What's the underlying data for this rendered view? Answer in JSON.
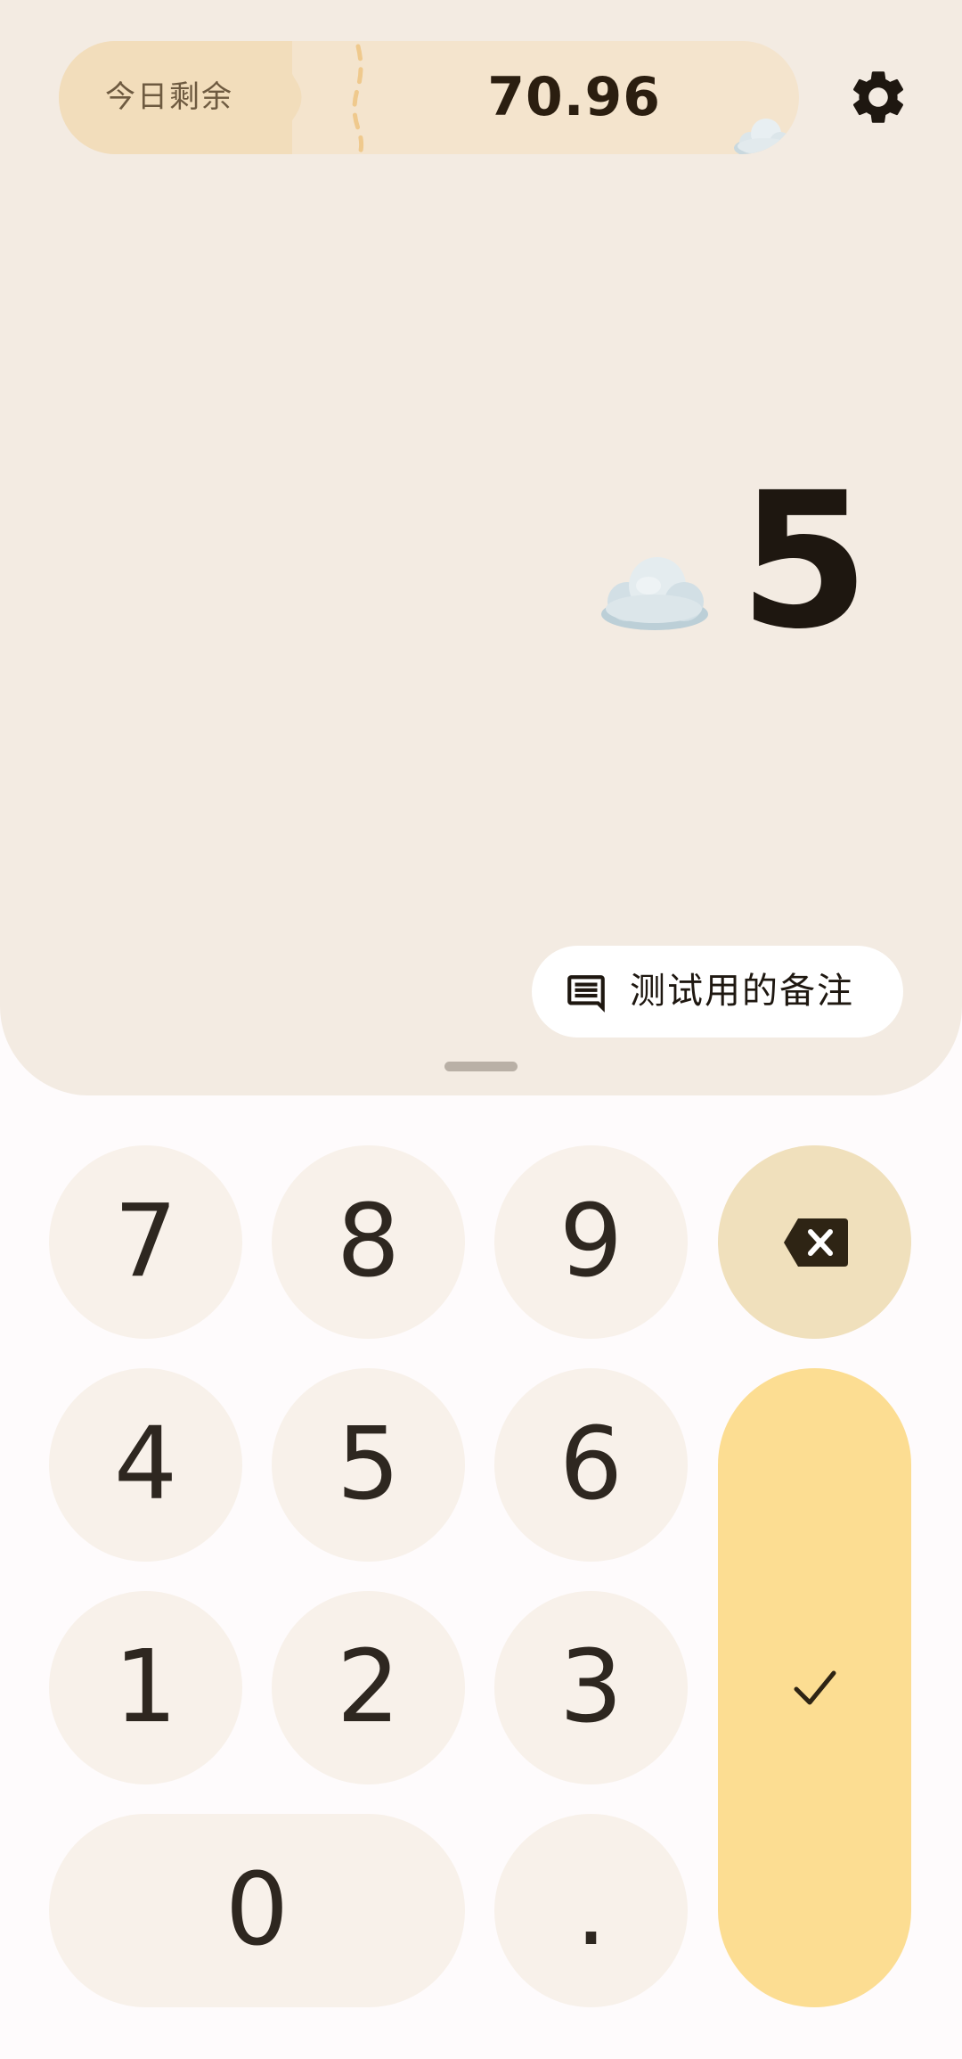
{
  "header": {
    "budget_label": "今日剩余",
    "budget_value": "70.96",
    "budget_icon": "cloud-icon",
    "settings_icon": "gear-icon"
  },
  "amount": {
    "value": "5",
    "category_icon": "cloud-icon"
  },
  "note": {
    "icon": "comment-icon",
    "text": "测试用的备注"
  },
  "keypad": {
    "keys": [
      "7",
      "8",
      "9",
      "4",
      "5",
      "6",
      "1",
      "2",
      "3",
      "0",
      "."
    ],
    "backspace_icon": "backspace-icon",
    "confirm_icon": "check-icon"
  },
  "colors": {
    "panel_bg": "#F3EBE2",
    "key_bg": "#F8F1EA",
    "backspace_bg": "#F0E0BC",
    "confirm_bg": "#FCDD92",
    "pill_bg": "#F4E4CD"
  }
}
